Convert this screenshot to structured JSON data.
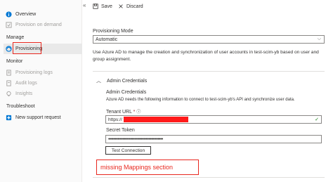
{
  "sidebar": {
    "items_top": [
      {
        "label": "Overview",
        "icon": "info-icon",
        "disabled": false
      },
      {
        "label": "Provision on demand",
        "icon": "provision-icon",
        "disabled": true
      }
    ],
    "manage_title": "Manage",
    "manage_items": [
      {
        "label": "Provisioning",
        "icon": "provisioning-icon",
        "selected": true
      }
    ],
    "monitor_title": "Monitor",
    "monitor_items": [
      {
        "label": "Provisioning logs",
        "icon": "logs-icon",
        "disabled": true
      },
      {
        "label": "Audit logs",
        "icon": "audit-icon",
        "disabled": true
      },
      {
        "label": "Insights",
        "icon": "insights-icon",
        "disabled": true
      }
    ],
    "troubleshoot_title": "Troubleshoot",
    "troubleshoot_items": [
      {
        "label": "New support request",
        "icon": "support-icon",
        "disabled": false
      }
    ],
    "collapse_glyph": "«"
  },
  "toolbar": {
    "save_label": "Save",
    "discard_label": "Discard"
  },
  "main": {
    "mode_label": "Provisioning Mode",
    "mode_value": "Automatic",
    "description": "Use Azure AD to manage the creation and synchronization of user accounts in test-scim-yb based on user and group assignment.",
    "admin_section_title": "Admin Credentials",
    "admin_heading": "Admin Credentials",
    "admin_desc": "Azure AD needs the following information to connect to test-scim-yb's API and synchronize user data.",
    "tenant_label": "Tenant URL",
    "tenant_required": "*",
    "tenant_value_prefix": "https://",
    "secret_label": "Secret Token",
    "secret_value": "••••••••••••••••••••••••••••••••••••••••••",
    "test_button": "Test Connection",
    "annotation": "missing Mappings section"
  },
  "colors": {
    "annotation": "#e8271e",
    "accent": "#0078d4",
    "select_border": "#8a8886"
  }
}
